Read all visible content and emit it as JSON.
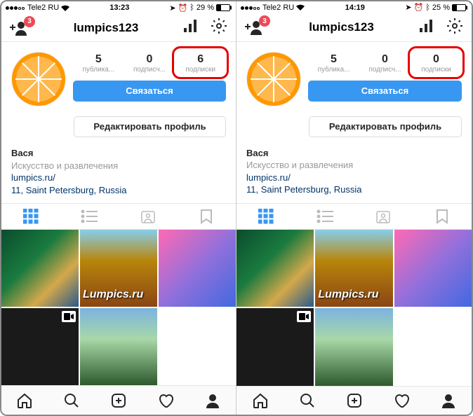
{
  "phones": [
    {
      "status": {
        "carrier": "Tele2 RU",
        "time": "13:23",
        "battery": "29 %"
      },
      "header": {
        "username": "lumpics123",
        "badge": "3"
      },
      "stats": {
        "posts": "5",
        "posts_lbl": "публика...",
        "followers": "0",
        "followers_lbl": "подписч...",
        "following": "6",
        "following_lbl": "подписки"
      },
      "buttons": {
        "contact": "Связаться",
        "edit": "Редактировать профиль"
      },
      "bio": {
        "name": "Вася",
        "category": "Искусство и развлечения",
        "link": "lumpics.ru/",
        "location": "11, Saint Petersburg, Russia"
      }
    },
    {
      "status": {
        "carrier": "Tele2 RU",
        "time": "14:19",
        "battery": "25 %"
      },
      "header": {
        "username": "lumpics123",
        "badge": "3"
      },
      "stats": {
        "posts": "5",
        "posts_lbl": "публика...",
        "followers": "0",
        "followers_lbl": "подписч...",
        "following": "0",
        "following_lbl": "подписки"
      },
      "buttons": {
        "contact": "Связаться",
        "edit": "Редактировать профиль"
      },
      "bio": {
        "name": "Вася",
        "category": "Искусство и развлечения",
        "link": "lumpics.ru/",
        "location": "11, Saint Petersburg, Russia"
      }
    }
  ]
}
